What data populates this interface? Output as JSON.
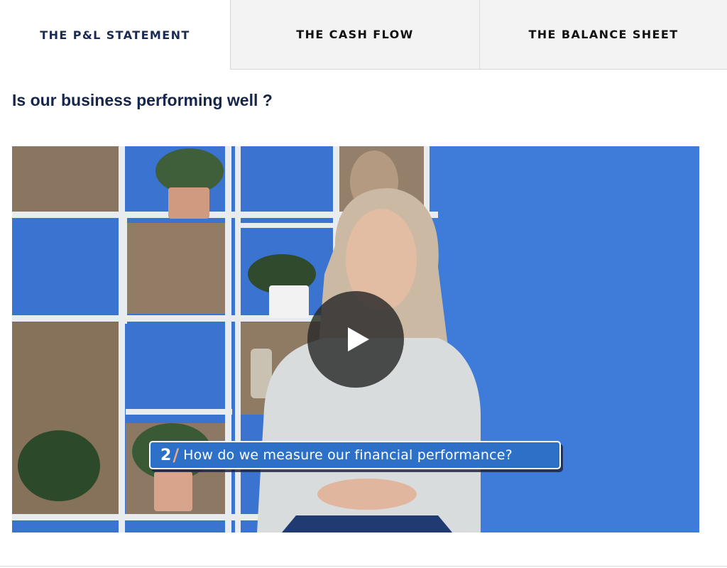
{
  "tabs": [
    {
      "label": "THE P&L STATEMENT",
      "active": true
    },
    {
      "label": "THE CASH FLOW",
      "active": false
    },
    {
      "label": "THE BALANCE SHEET",
      "active": false
    }
  ],
  "section": {
    "heading": "Is our business performing well ?"
  },
  "video": {
    "play_icon": "play-icon",
    "caption": {
      "number": "2",
      "separator": "/",
      "text": "How do we measure our financial performance?"
    }
  },
  "colors": {
    "heading": "#15264a",
    "active_tab_text": "#1a2b52",
    "inactive_tab_bg": "#f3f3f3",
    "video_wall": "#3a73d0",
    "caption_bg": "#2c70c8",
    "caption_slash": "#e7a88c"
  }
}
